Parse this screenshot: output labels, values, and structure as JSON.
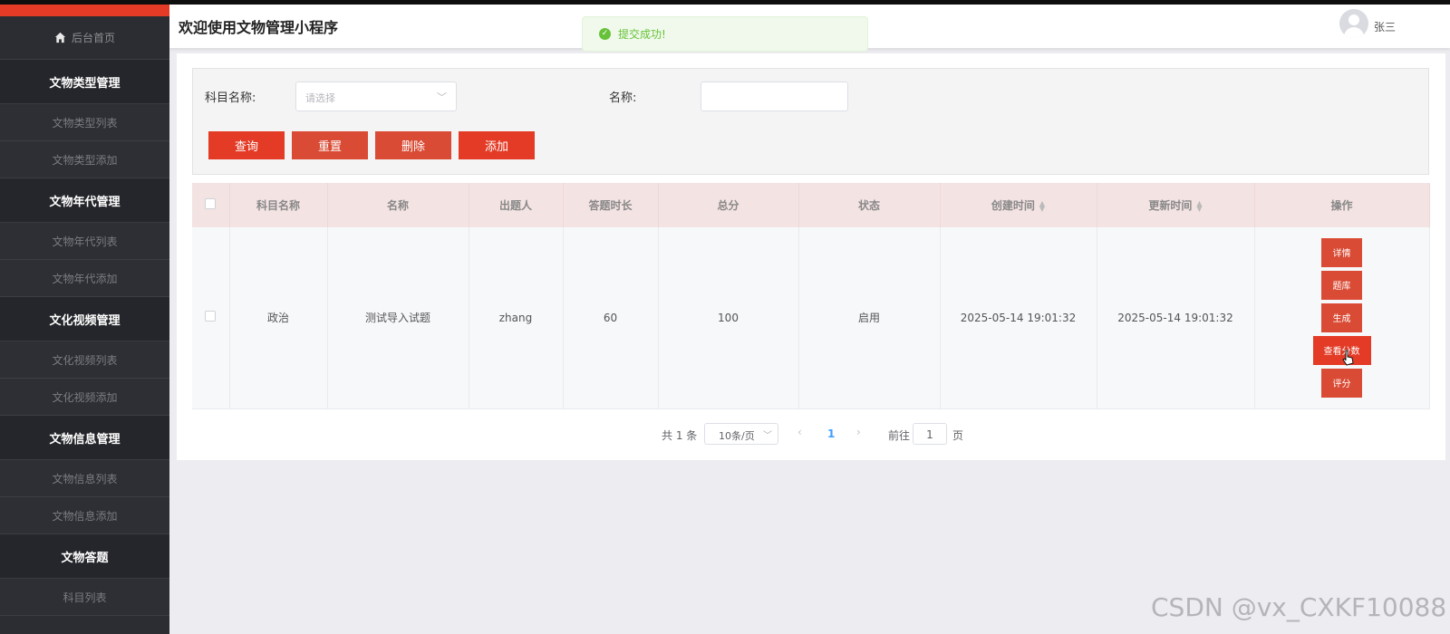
{
  "app": {
    "title": "欢迎使用文物管理小程序",
    "user": "张三"
  },
  "toast": {
    "message": "提交成功!",
    "color": "#67c23a"
  },
  "colors": {
    "accent": "#e33b26",
    "sidebar_bg": "#2c2d32",
    "table_header_bg": "#f4e3e3"
  },
  "sidebar": {
    "home": "后台首页",
    "groups": [
      {
        "title": "文物类型管理",
        "items": [
          "文物类型列表",
          "文物类型添加"
        ]
      },
      {
        "title": "文物年代管理",
        "items": [
          "文物年代列表",
          "文物年代添加"
        ]
      },
      {
        "title": "文化视频管理",
        "items": [
          "文化视频列表",
          "文化视频添加"
        ]
      },
      {
        "title": "文物信息管理",
        "items": [
          "文物信息列表",
          "文物信息添加"
        ]
      },
      {
        "title": "文物答题",
        "items": [
          "科目列表"
        ]
      }
    ]
  },
  "filter": {
    "subject_label": "科目名称:",
    "subject_placeholder": "请选择",
    "name_label": "名称:",
    "name_value": "",
    "buttons": {
      "query": "查询",
      "reset": "重置",
      "delete": "删除",
      "add": "添加"
    }
  },
  "table": {
    "columns": [
      "科目名称",
      "名称",
      "出题人",
      "答题时长",
      "总分",
      "状态",
      "创建时间",
      "更新时间",
      "操作"
    ],
    "rows": [
      {
        "subject": "政治",
        "name": "测试导入试题",
        "author": "zhang",
        "duration": "60",
        "total": "100",
        "status": "启用",
        "created": "2025-05-14 19:01:32",
        "updated": "2025-05-14 19:01:32",
        "actions": [
          "详情",
          "题库",
          "生成",
          "查看分数",
          "评分"
        ]
      }
    ]
  },
  "pagination": {
    "total": "共 1 条",
    "page_size": "10条/页",
    "current": "1",
    "goto_label": "前往",
    "goto_value": "1",
    "page_unit": "页"
  },
  "watermark": "CSDN @vx_CXKF10088"
}
